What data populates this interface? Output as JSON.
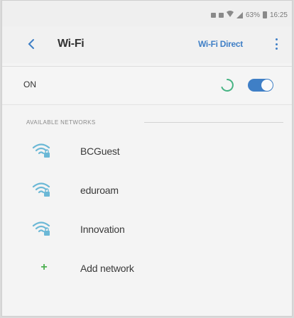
{
  "status_bar": {
    "icons": [
      "vibrate-icon",
      "sd-card-icon",
      "wifi-status-icon",
      "signal-icon",
      "battery-icon"
    ],
    "battery_text": "63%",
    "time": "16:25"
  },
  "header": {
    "title": "Wi-Fi",
    "wifi_direct_label": "Wi-Fi Direct",
    "back_icon": "chevron-left-icon",
    "more_icon": "more-vertical-icon"
  },
  "toggle_row": {
    "label": "ON",
    "state": true
  },
  "available_networks": {
    "heading": "AVAILABLE NETWORKS",
    "items": [
      {
        "name": "BCGuest",
        "icon": "wifi-locked-icon",
        "secured": true
      },
      {
        "name": "eduroam",
        "icon": "wifi-locked-icon",
        "secured": true
      },
      {
        "name": "Innovation",
        "icon": "wifi-locked-icon",
        "secured": true
      }
    ],
    "add_network_label": "Add network"
  },
  "colors": {
    "accent": "#3f7fc6",
    "wifi_icon": "#6bb8d6",
    "add_icon": "#4caf50"
  }
}
